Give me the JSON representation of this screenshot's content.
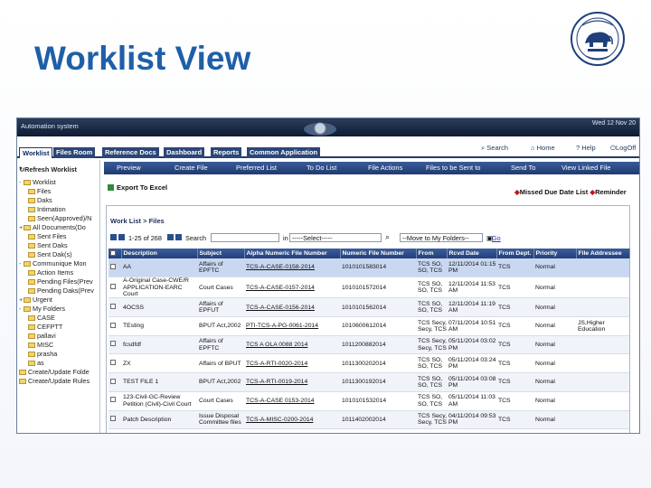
{
  "slide": {
    "title": "Worklist View"
  },
  "app": {
    "name": "Automation system",
    "date_text": "Wed 12 Nov 20",
    "top_links": [
      "Search",
      "Home",
      "Help",
      "LogOff"
    ],
    "tabs": [
      "Worklist",
      "Files Room",
      "Reference Docs",
      "Dashboard",
      "Reports",
      "Common Application"
    ]
  },
  "sidebar": {
    "refresh": "Refresh Worklist",
    "items": [
      "Worklist",
      "Files",
      "Daks",
      "Intimation",
      "Seen(Approved)/N",
      "All Documents(Do",
      "Sent Files",
      "Sent Daks",
      "Sent Dak(s)",
      "Communique Mon",
      "Action Items",
      "Pending Files(Prev",
      "Pending Daks(Prev",
      "Urgent",
      "My Folders",
      "CASE",
      "CEFPTT",
      "pallavi",
      "MISC",
      "prasha",
      "as",
      "Create/Update Folde",
      "Create/Update Rules"
    ]
  },
  "actions": [
    "Preview",
    "Create File",
    "Preferred List",
    "To Do List",
    "File Actions",
    "Files to be Sent to",
    "Send To",
    "View Linked File"
  ],
  "toolbar": {
    "export": "Export To Excel",
    "missed": "Missed Due Date List",
    "reminder": "Reminder"
  },
  "worklist": {
    "breadcrumb": "Work List > Files",
    "range": "1-25 of 268",
    "search_label": "Search",
    "in_label": "in",
    "select_value": "-----Select-----",
    "move_value": "--Move to My Folders--",
    "go": "Go",
    "columns": [
      "",
      "Description",
      "Subject",
      "Alpha Numeric File Number",
      "Numeric File Number",
      "From",
      "Rcvd Date",
      "From Dept.",
      "Priority",
      "File Addressee"
    ],
    "rows": [
      {
        "desc": "AA",
        "subject": "Affairs of EPFTC",
        "alpha": "TCS-A-CASE-0158-2014",
        "num": "1010101583014",
        "from": "TCS SO, SO, TCS",
        "date": "12/11/2014 01:15 PM",
        "dept": "TCS",
        "priority": "Normal",
        "addressee": ""
      },
      {
        "desc": "A-Original Case-CWE/R APPLICATION-EARC Court",
        "subject": "Court Cases",
        "alpha": "TCS-A-CASE-0157-2014",
        "num": "1010101572014",
        "from": "TCS SO, SO, TCS",
        "date": "12/11/2014 11:53 AM",
        "dept": "TCS",
        "priority": "Normal",
        "addressee": ""
      },
      {
        "desc": "4OCSS",
        "subject": "Affairs of EPFUT",
        "alpha": "TCS-A-CASE-0156-2014",
        "num": "1010101562014",
        "from": "TCS SO, SO, TCS",
        "date": "12/11/2014 11:19 AM",
        "dept": "TCS",
        "priority": "Normal",
        "addressee": ""
      },
      {
        "desc": "TEsting",
        "subject": "BPUT Act,2002",
        "alpha": "PTI-TCS-A-PG-0061-2014",
        "num": "1010600612014",
        "from": "TCS Secy, Secy, TCS",
        "date": "07/11/2014 10:51 AM",
        "dept": "TCS",
        "priority": "Normal",
        "addressee": "JS,Higher Education"
      },
      {
        "desc": "fcsdfdf",
        "subject": "Affairs of EPFTC",
        "alpha": "TCS A OLA 0088 2014",
        "num": "1011200882014",
        "from": "TCS Secy, Secy, TCS",
        "date": "05/11/2014 03:02 PM",
        "dept": "TCS",
        "priority": "Normal",
        "addressee": ""
      },
      {
        "desc": "ZX",
        "subject": "Affairs of BPUT",
        "alpha": "TCS-A-RTI-0020-2014",
        "num": "1011300202014",
        "from": "TCS SO, SO, TCS",
        "date": "05/11/2014 03:24 PM",
        "dept": "TCS",
        "priority": "Normal",
        "addressee": ""
      },
      {
        "desc": "TEST FILE 1",
        "subject": "BPUT Act,2002",
        "alpha": "TCS-A-RTI-0019-2014",
        "num": "1011300192014",
        "from": "TCS SO, SO, TCS",
        "date": "05/11/2014 03:08 PM",
        "dept": "TCS",
        "priority": "Normal",
        "addressee": ""
      },
      {
        "desc": "123-Civil-GC-Review Petition (Civil)-Civil Court",
        "subject": "Court Cases",
        "alpha": "TCS-A-CASE 0153-2014",
        "num": "1010101532014",
        "from": "TCS SO, SO, TCS",
        "date": "05/11/2014 11:03 AM",
        "dept": "TCS",
        "priority": "Normal",
        "addressee": ""
      },
      {
        "desc": "Patch Description",
        "subject": "Issue Disposal Committee files",
        "alpha": "TCS-A-MISC-0200-2014",
        "num": "1011402002014",
        "from": "TCS Secy, Secy, TCS",
        "date": "04/11/2014 09:53 PM",
        "dept": "TCS",
        "priority": "Normal",
        "addressee": ""
      }
    ]
  }
}
